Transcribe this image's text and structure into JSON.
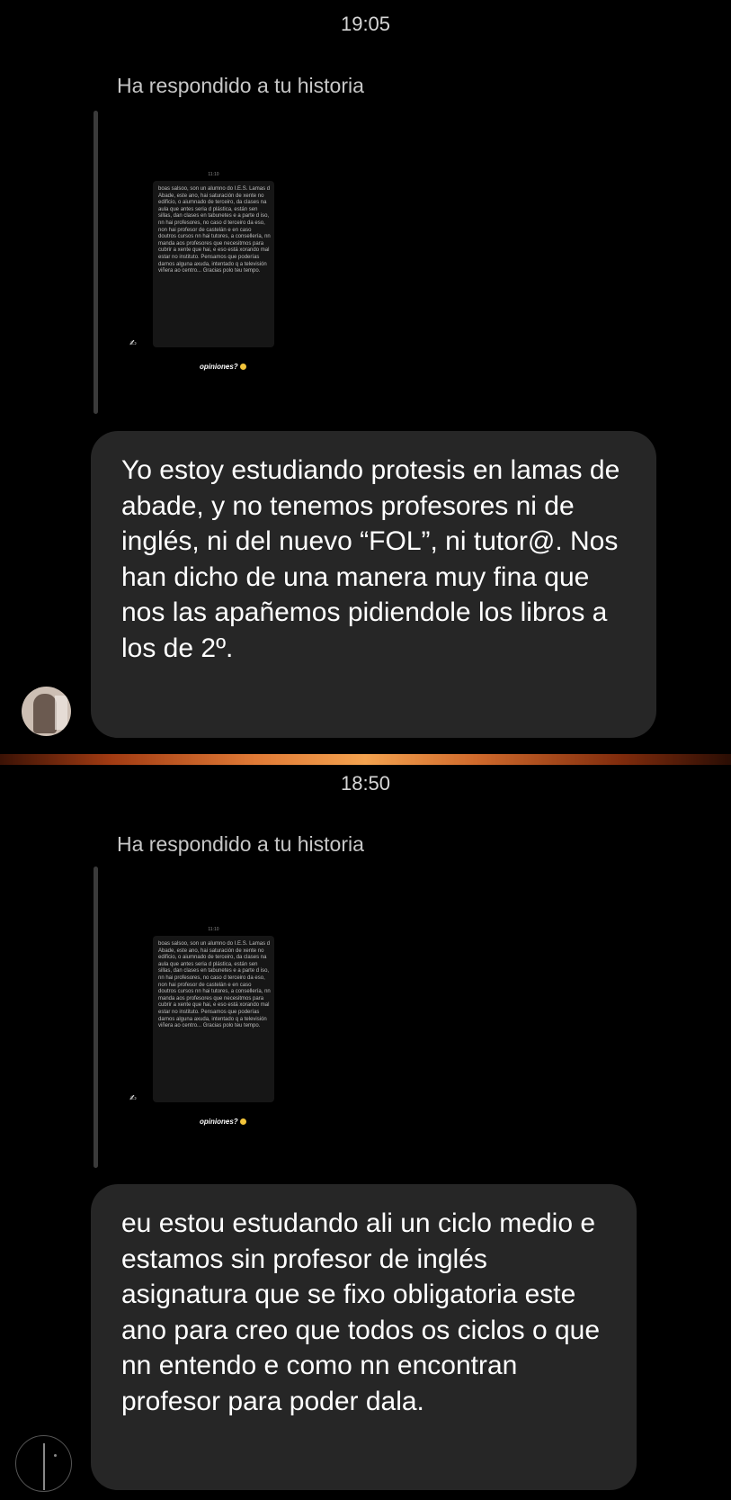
{
  "conversations": [
    {
      "timestamp": "19:05",
      "reply_label": "Ha respondido a tu historia",
      "story": {
        "top_text": "11:10",
        "text": "boas salsoo, son un alumno do I.E.S. Lamas d Abade, este ano, hai saturación de xente no edificio, o aiumnado de terceiro, da clases na aula que antes seria d plástica, están sen sillas, dan clases en tabunetes e a parte d iso, nn hai profesores, no caso d terceiro da eso, non hai profesor de castelán e en caso doutros cursos nn hai tutores, a consellería, nn manda aos profesores que necesitmos para cubrir a xente que hai, e eso está xorando mal estar no instituto. Pensamos que poderías darnos alguna axuda, intentado q a televisión viñera ao centro... Gracias polo teu tempo.",
        "opinion": "opiniones?",
        "emoji_icon": "hand-emoji-icon"
      },
      "message": "Yo estoy estudiando protesis en lamas de abade, y no tenemos profesores ni de inglés, ni del nuevo “FOL”, ni tutor@. Nos han dicho de una manera muy fina que nos las apañemos pidiendole los libros a los de 2º."
    },
    {
      "timestamp": "18:50",
      "reply_label": "Ha respondido a tu historia",
      "story": {
        "top_text": "11:10",
        "text": "boas salsoo, son un alumno do I.E.S. Lamas d Abade, este ano, hai saturación de xente no edificio, o aiumnado de terceiro, da clases na aula que antes seria d plástica, están sen sillas, dan clases en tabunetes e a parte d iso, nn hai profesores, no caso d terceiro da eso, non hai profesor de castelán e en caso doutros cursos nn hai tutores, a consellería, nn manda aos profesores que necesitmos para cubrir a xente que hai, e eso está xorando mal estar no instituto. Pensamos que poderías darnos alguna axuda, intentado q a televisión viñera ao centro... Gracias polo teu tempo.",
        "opinion": "opiniones?",
        "emoji_icon": "hand-emoji-icon"
      },
      "message": "eu estou estudando ali un ciclo medio e estamos sin profesor de inglés asignatura que se fixo obligatoria este ano para creo que todos os ciclos o que nn entendo e como nn encontran profesor para poder dala."
    }
  ],
  "colors": {
    "background": "#000000",
    "bubble": "#262626",
    "divider_accent": "#e07a36"
  }
}
